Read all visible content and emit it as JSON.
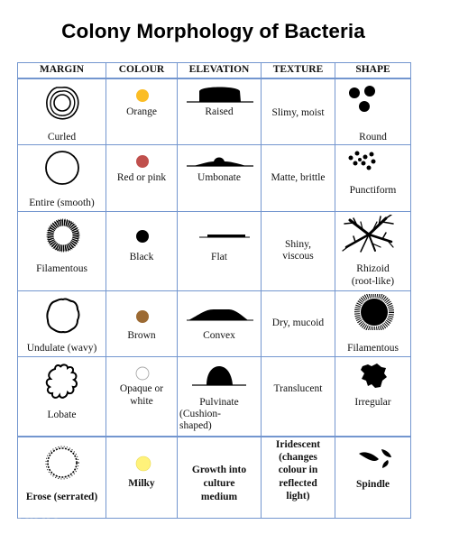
{
  "title": "Colony Morphology of Bacteria",
  "headers": [
    "MARGIN",
    "COLOUR",
    "ELEVATION",
    "TEXTURE",
    "SHAPE"
  ],
  "rows": [
    {
      "margin": {
        "label": "Curled",
        "icon": "curled-margin-icon"
      },
      "colour": {
        "label": "Orange",
        "swatch": "#fbbd25"
      },
      "elevation": {
        "label": "Raised",
        "icon": "raised-elevation-icon"
      },
      "texture": {
        "label": "Slimy, moist"
      },
      "shape": {
        "label": "Round",
        "icon": "round-shape-icon"
      }
    },
    {
      "margin": {
        "label": "Entire (smooth)",
        "icon": "entire-margin-icon"
      },
      "colour": {
        "label": "Red or pink",
        "swatch": "#c0504d"
      },
      "elevation": {
        "label": "Umbonate",
        "icon": "umbonate-elevation-icon"
      },
      "texture": {
        "label": "Matte, brittle"
      },
      "shape": {
        "label": "Punctiform",
        "icon": "punctiform-shape-icon"
      }
    },
    {
      "margin": {
        "label": "Filamentous",
        "icon": "filamentous-margin-icon"
      },
      "colour": {
        "label": "Black",
        "swatch": "#000000"
      },
      "elevation": {
        "label": "Flat",
        "icon": "flat-elevation-icon"
      },
      "texture": {
        "label_lines": [
          "Shiny,",
          "viscous"
        ]
      },
      "shape": {
        "label_lines": [
          "Rhizoid",
          "(root-like)"
        ],
        "icon": "rhizoid-shape-icon"
      }
    },
    {
      "margin": {
        "label": "Undulate (wavy)",
        "icon": "undulate-margin-icon"
      },
      "colour": {
        "label": "Brown",
        "swatch": "#9c6a33"
      },
      "elevation": {
        "label": "Convex",
        "icon": "convex-elevation-icon"
      },
      "texture": {
        "label": "Dry, mucoid"
      },
      "shape": {
        "label": "Filamentous",
        "icon": "filamentous-shape-icon"
      }
    },
    {
      "margin": {
        "label": "Lobate",
        "icon": "lobate-margin-icon"
      },
      "colour": {
        "label_lines": [
          "Opaque or",
          "white"
        ],
        "swatch": "#ffffff"
      },
      "elevation": {
        "label_lines": [
          "Pulvinate",
          "(Cushion-",
          "shaped)"
        ],
        "icon": "pulvinate-elevation-icon"
      },
      "texture": {
        "label": "Translucent"
      },
      "shape": {
        "label": "Irregular",
        "icon": "irregular-shape-icon"
      }
    },
    {
      "margin": {
        "label": "Erose (serrated)",
        "icon": "erose-margin-icon"
      },
      "colour": {
        "label": "Milky",
        "swatch": "#fff27a"
      },
      "elevation": {
        "label_lines": [
          "Growth into",
          "culture",
          "medium"
        ]
      },
      "texture": {
        "label_lines": [
          "Iridescent",
          "(changes",
          "colour in",
          "reflected",
          "light)"
        ]
      },
      "shape": {
        "label": "Spindle",
        "icon": "spindle-shape-icon"
      }
    }
  ],
  "footnote": "–    –––   –– –"
}
